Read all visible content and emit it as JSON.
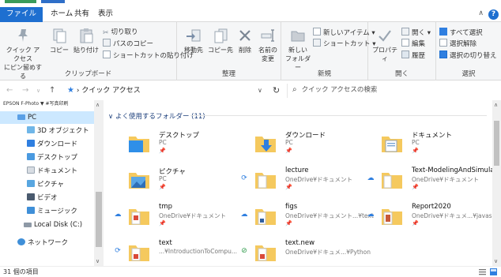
{
  "ribbon_tabs": [
    "ファイル",
    "ホーム",
    "共有",
    "表示"
  ],
  "ribbon": {
    "clipboard": {
      "label": "クリップボード",
      "pin_label_1": "クイック アクセス",
      "pin_label_2": "にピン留めする",
      "copy_label": "コピー",
      "paste_label": "貼り付け",
      "cut_label": "切り取り",
      "copy_path_label": "パスのコピー",
      "paste_shortcut_label": "ショートカットの貼り付け"
    },
    "organize": {
      "label": "整理",
      "move_to_label": "移動先",
      "copy_to_label": "コピー先",
      "delete_label": "削除",
      "rename_label_1": "名前の",
      "rename_label_2": "変更"
    },
    "new": {
      "label": "新規",
      "new_folder_label_1": "新しい",
      "new_folder_label_2": "フォルダー",
      "new_item_label": "新しいアイテム",
      "shortcut_label": "ショートカット"
    },
    "open": {
      "label": "開く",
      "properties_label": "プロパティ",
      "open_label": "開く",
      "edit_label": "編集",
      "history_label": "履歴"
    },
    "select": {
      "label": "選択",
      "select_all_label": "すべて選択",
      "select_none_label": "選択解除",
      "invert_label": "選択の切り替え"
    }
  },
  "address": {
    "path": "クイック アクセス",
    "search_placeholder": "クイック アクセスの検索"
  },
  "nav_pane": {
    "top_text": "EPSON F-Photo ▼ #写真印刷",
    "items": [
      {
        "label": "PC",
        "icon": "pc-icon"
      },
      {
        "label": "3D オブジェクト",
        "icon": "3d-objects-icon"
      },
      {
        "label": "ダウンロード",
        "icon": "download-folder-icon"
      },
      {
        "label": "デスクトップ",
        "icon": "desktop-folder-icon"
      },
      {
        "label": "ドキュメント",
        "icon": "documents-folder-icon"
      },
      {
        "label": "ピクチャ",
        "icon": "pictures-folder-icon"
      },
      {
        "label": "ビデオ",
        "icon": "videos-folder-icon"
      },
      {
        "label": "ミュージック",
        "icon": "music-folder-icon"
      },
      {
        "label": "Local Disk (C:)",
        "icon": "disk-icon"
      },
      {
        "label": "ネットワーク",
        "icon": "network-icon"
      }
    ]
  },
  "content": {
    "group_header": "よく使用するフォルダー (11)",
    "tiles": [
      {
        "name": "デスクトップ",
        "sub": "PC"
      },
      {
        "name": "ダウンロード",
        "sub": "PC"
      },
      {
        "name": "ドキュメント",
        "sub": "PC"
      },
      {
        "name": "ピクチャ",
        "sub": "PC"
      },
      {
        "name": "lecture",
        "sub": "OneDrive¥ドキュメント"
      },
      {
        "name": "Text-ModelingAndSimula...",
        "sub": "OneDrive¥ドキュメント"
      },
      {
        "name": "tmp",
        "sub": "OneDrive¥ドキュメント"
      },
      {
        "name": "figs",
        "sub": "OneDrive¥ドキュメント...¥text"
      },
      {
        "name": "Report2020",
        "sub": "OneDrive¥ドキュメ...¥javasrc"
      },
      {
        "name": "text",
        "sub": "...¥IntroductionToCompu..."
      },
      {
        "name": "text.new",
        "sub": "OneDrive¥ドキュメ...¥Python"
      }
    ]
  },
  "status": {
    "item_count": "31 個の項目"
  },
  "colors": {
    "accent": "#1e6fd0",
    "folder": "#f5c95e",
    "selected": "#cce8ff"
  }
}
